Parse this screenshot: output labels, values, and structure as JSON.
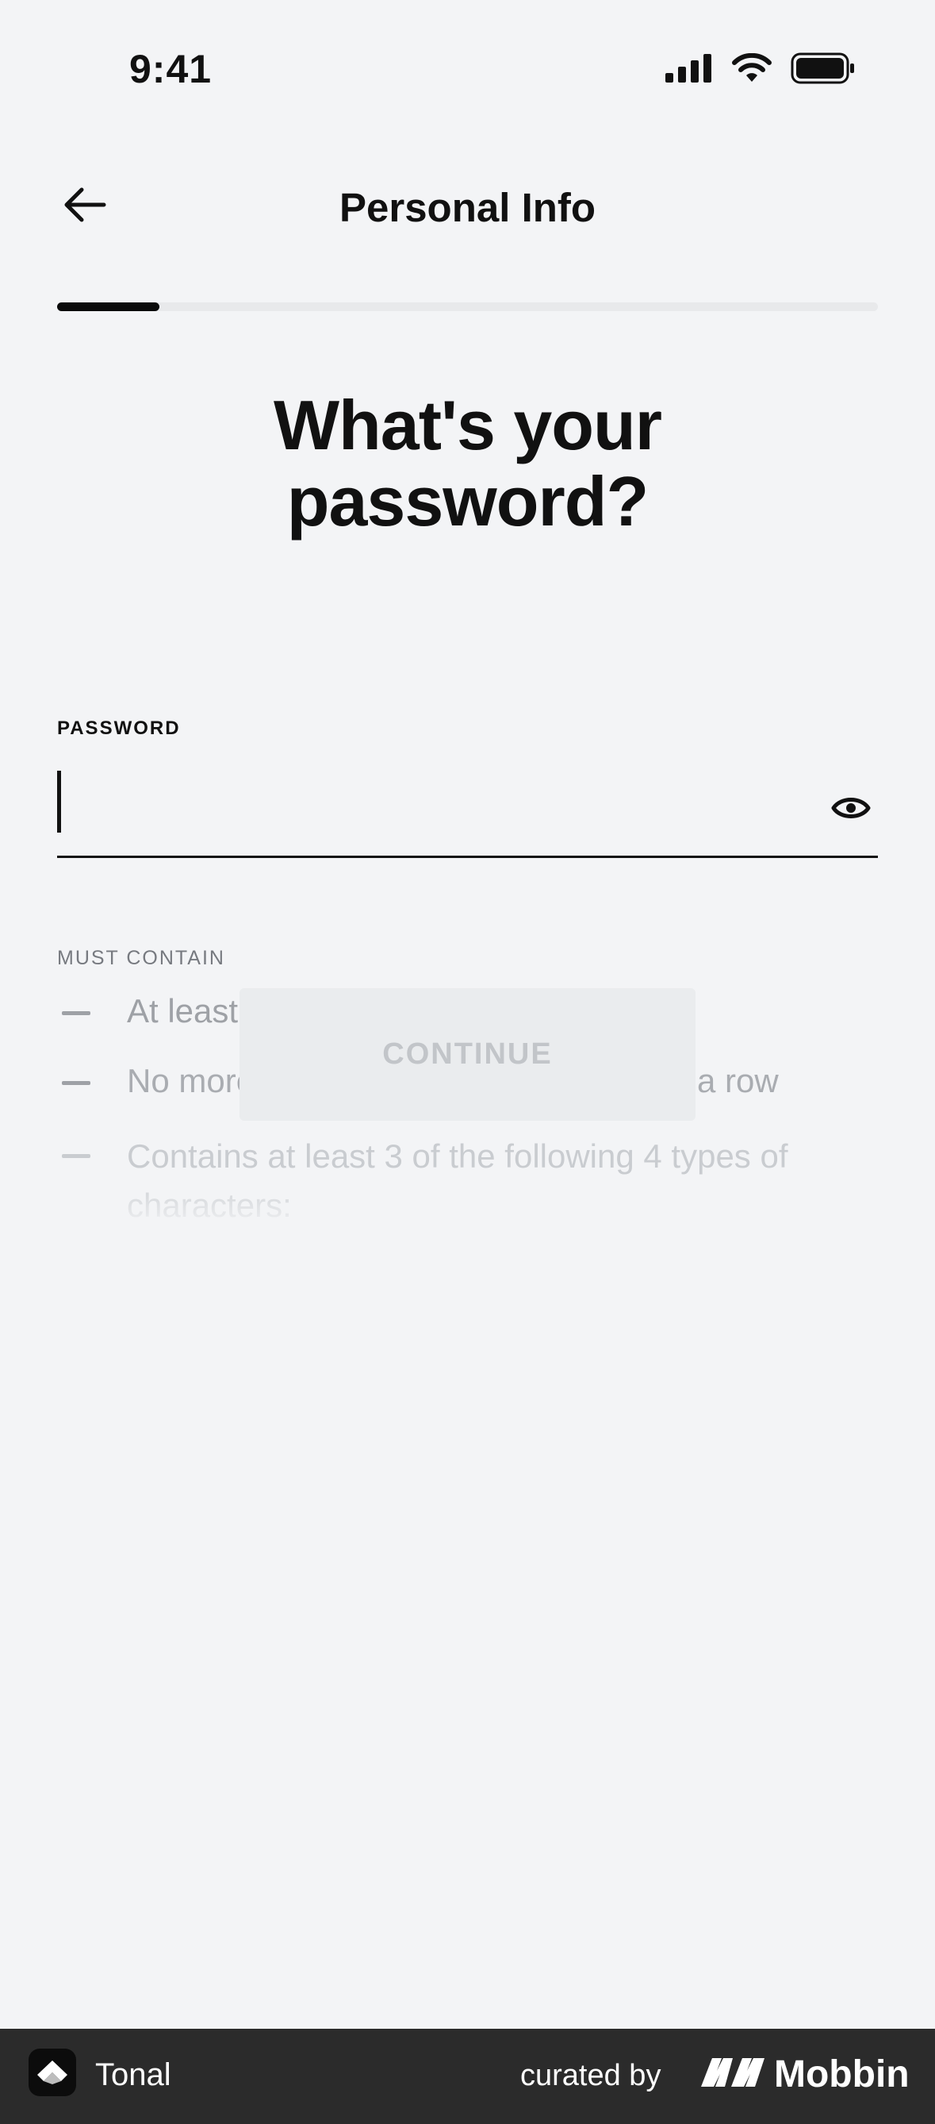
{
  "status_bar": {
    "time": "9:41",
    "icons": [
      "cellular-signal-icon",
      "wifi-icon",
      "battery-icon"
    ]
  },
  "nav": {
    "back_icon": "arrow-left-icon",
    "title": "Personal Info"
  },
  "progress": {
    "step_fraction": 0.125
  },
  "heading": {
    "line1": "What's your",
    "line2": "password?"
  },
  "password_field": {
    "label": "PASSWORD",
    "value": "",
    "placeholder": "",
    "toggle_icon": "eye-icon"
  },
  "requirements": {
    "header": "MUST CONTAIN",
    "items": [
      "At least",
      "No more than 2 identical characters in a row",
      "Contains at least 3 of the following 4 types of characters:"
    ]
  },
  "continue_button": {
    "label": "CONTINUE"
  },
  "footer": {
    "app_name": "Tonal",
    "curated_by": "curated by",
    "brand": "Mobbin"
  },
  "colors": {
    "background": "#f3f4f6",
    "text": "#111111",
    "muted": "#9ea1a6",
    "button_disabled_bg": "#eaecee",
    "button_disabled_text": "#c2c5c9",
    "footer_bg": "#2b2b2b"
  }
}
